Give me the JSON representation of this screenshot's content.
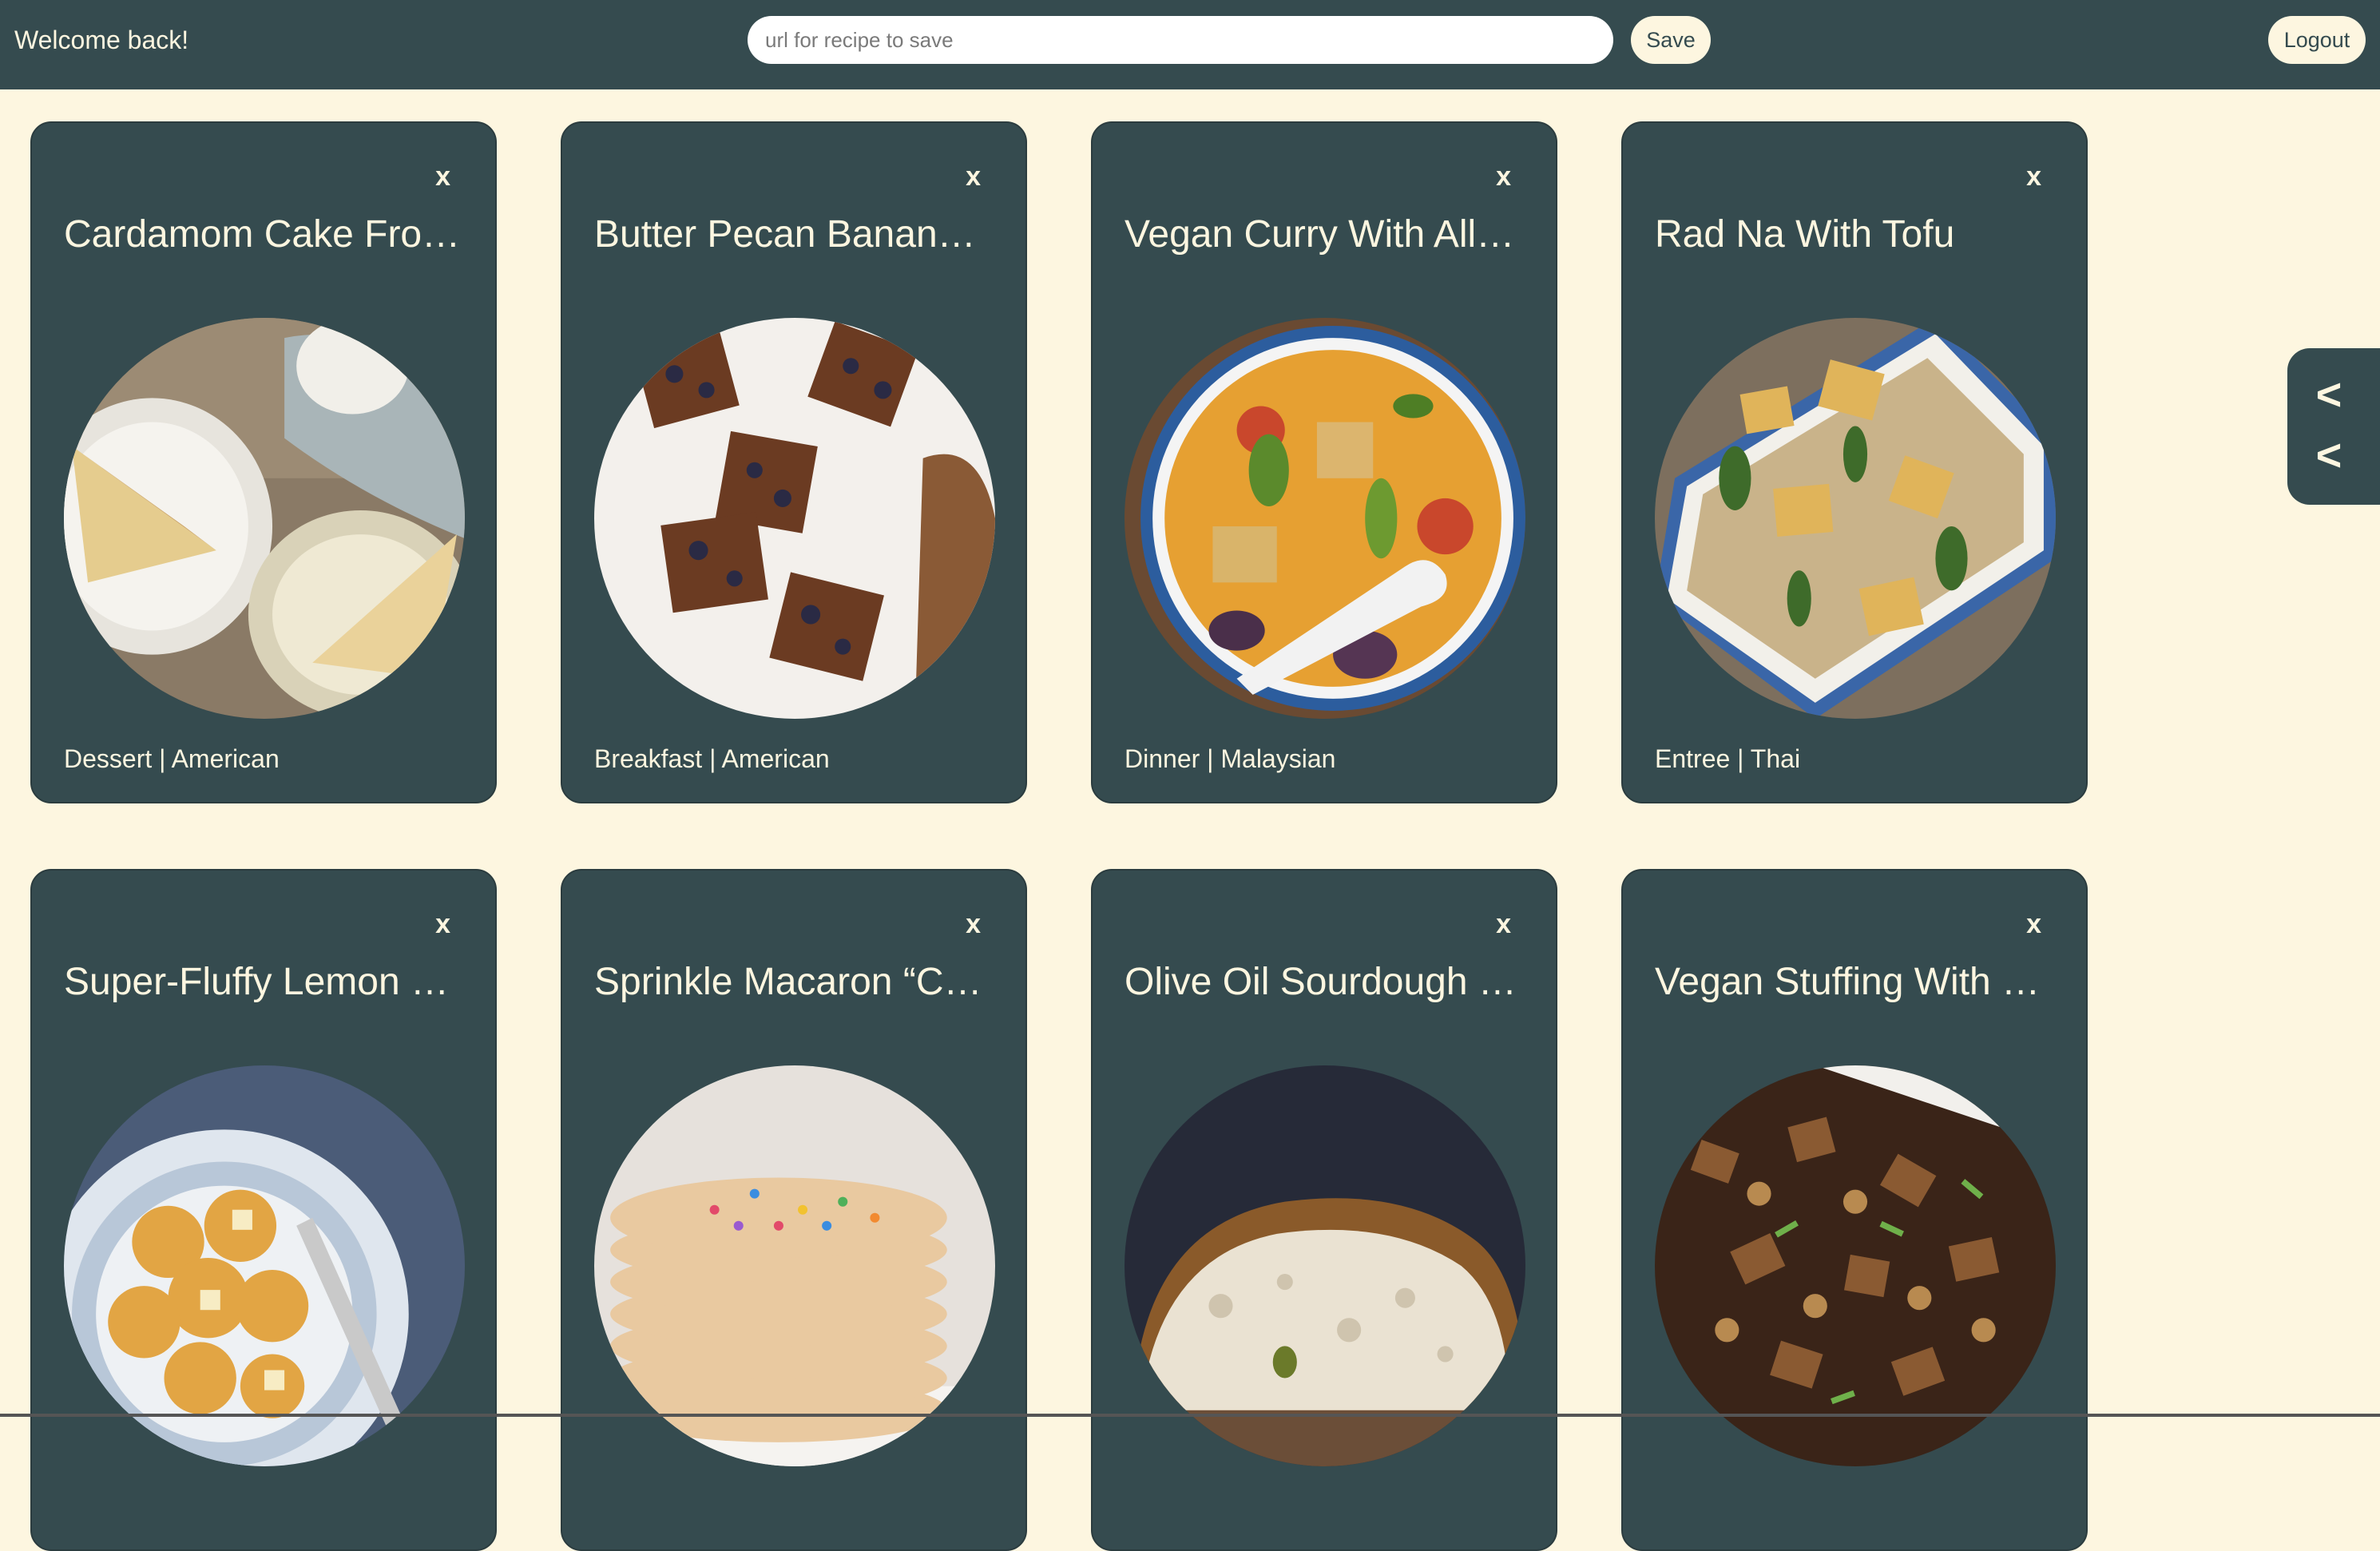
{
  "header": {
    "welcome": "Welcome back!",
    "url_placeholder": "url for recipe to save",
    "save_label": "Save",
    "logout_label": "Logout"
  },
  "side_panel": {
    "toggle_1": "<",
    "toggle_2": "<"
  },
  "cards": [
    {
      "title": "Cardamom Cake From Sweden",
      "tags": "Dessert | American",
      "close": "x",
      "image": "cardamom-cake-photo"
    },
    {
      "title": "Butter Pecan Banana Bread",
      "tags": "Breakfast | American",
      "close": "x",
      "image": "blueberry-bars-photo"
    },
    {
      "title": "Vegan Curry With All the Vegetables",
      "tags": "Dinner | Malaysian",
      "close": "x",
      "image": "vegan-curry-photo"
    },
    {
      "title": "Rad Na With Tofu",
      "tags": "Entree | Thai",
      "close": "x",
      "image": "rad-na-photo"
    },
    {
      "title": "Super-Fluffy Lemon Pancakes",
      "tags": "",
      "close": "x",
      "image": "lemon-pancakes-photo"
    },
    {
      "title": "Sprinkle Macaron “Cake”",
      "tags": "",
      "close": "x",
      "image": "sprinkle-cake-photo"
    },
    {
      "title": "Olive Oil Sourdough Bread",
      "tags": "",
      "close": "x",
      "image": "sourdough-photo"
    },
    {
      "title": "Vegan Stuffing With Mushrooms",
      "tags": "",
      "close": "x",
      "image": "vegan-stuffing-photo"
    }
  ],
  "colors": {
    "header_bg": "#354b4f",
    "card_bg": "#354b4f",
    "page_bg": "#fdf6e0",
    "text_light": "#fdf6e0"
  }
}
